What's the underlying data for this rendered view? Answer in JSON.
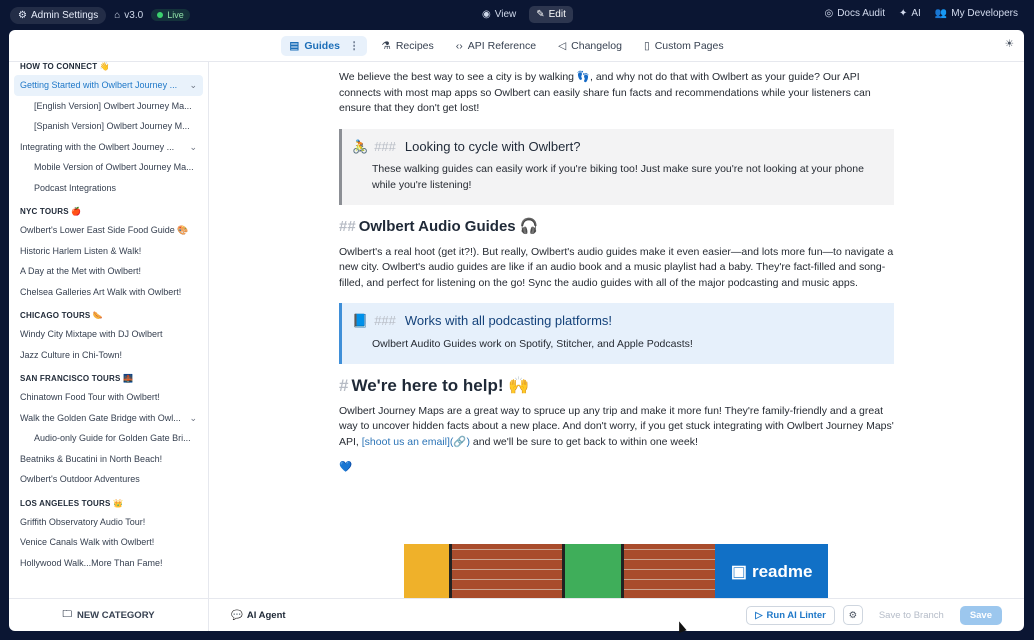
{
  "topbar": {
    "admin_label": "Admin Settings",
    "version": "v3.0",
    "live": "Live",
    "view": "View",
    "edit": "Edit",
    "docs_audit": "Docs Audit",
    "ai": "AI",
    "my_developers": "My Developers"
  },
  "nav": {
    "items": [
      {
        "label": "Guides"
      },
      {
        "label": "Recipes"
      },
      {
        "label": "API Reference"
      },
      {
        "label": "Changelog"
      },
      {
        "label": "Custom Pages"
      }
    ]
  },
  "sidebar": {
    "groups": [
      {
        "title": "HOW TO CONNECT 👋",
        "items": [
          {
            "label": "Getting Started with Owlbert Journey ..."
          },
          {
            "label": "[English Version] Owlbert Journey Ma..."
          },
          {
            "label": "[Spanish Version] Owlbert Journey M..."
          },
          {
            "label": "Integrating with the Owlbert Journey ..."
          },
          {
            "label": "Mobile Version of Owlbert Journey Ma..."
          },
          {
            "label": "Podcast Integrations"
          }
        ]
      },
      {
        "title": "NYC TOURS 🍎",
        "items": [
          {
            "label": "Owlbert's Lower East Side Food Guide 🎨"
          },
          {
            "label": "Historic Harlem Listen & Walk!"
          },
          {
            "label": "A Day at the Met with Owlbert!"
          },
          {
            "label": "Chelsea Galleries Art Walk with Owlbert!"
          }
        ]
      },
      {
        "title": "CHICAGO TOURS 🌭",
        "items": [
          {
            "label": "Windy City Mixtape with DJ Owlbert"
          },
          {
            "label": "Jazz Culture in Chi-Town!"
          }
        ]
      },
      {
        "title": "SAN FRANCISCO TOURS 🌉",
        "items": [
          {
            "label": "Chinatown Food Tour with Owlbert!"
          },
          {
            "label": "Walk the Golden Gate Bridge with Owl..."
          },
          {
            "label": "Audio-only Guide for Golden Gate Bri..."
          },
          {
            "label": "Beatniks & Bucatini in North Beach!"
          },
          {
            "label": "Owlbert's Outdoor Adventures"
          }
        ]
      },
      {
        "title": "LOS ANGELES TOURS 👑",
        "items": [
          {
            "label": "Griffith Observatory Audio Tour!"
          },
          {
            "label": "Venice Canals Walk with Owlbert!"
          },
          {
            "label": "Hollywood Walk...More Than Fame!"
          }
        ]
      }
    ]
  },
  "content": {
    "intro": "We believe the best way to see a city is by walking 👣, and why not do that with Owlbert as your guide? Our API connects with most map apps so Owlbert can easily share fun facts and recommendations while your listeners can ensure that they don't get lost!",
    "callout1_hash": "###",
    "callout1_title": "Looking to cycle with Owlbert?",
    "callout1_body": "These walking guides can easily work if you're biking too! Just make sure you're not looking at your phone while you're listening!",
    "h2_hash": "##",
    "h2_title": "Owlbert Audio Guides 🎧",
    "para2": "Owlbert's a real hoot (get it?!). But really, Owlbert's audio guides make it even easier—and lots more fun—to navigate a new city. Owlbert's audio guides are like if an audio book and a music playlist had a baby. They're fact-filled and song-filled, and perfect for listening on the go! Sync the audio guides with all of the major podcasting and music apps.",
    "callout2_hash": "###",
    "callout2_title": "Works with all podcasting platforms!",
    "callout2_body": "Owlbert Audito Guides work on Spotify, Stitcher, and Apple Podcasts!",
    "h1_hash": "#",
    "h1_title": "We're here to help! 🙌",
    "para3_a": "Owlbert Journey Maps are a great way to spruce up any trip and make it more fun! They're family-friendly and a great way to uncover hidden facts about a new place. And don't worry, if you get stuck integrating with Owlbert Journey Maps' API,",
    "para3_link": "[shoot us an email](🔗)",
    "para3_b": "and we'll be sure to get back to within one week!",
    "heart": "💙",
    "banner_text": "readme"
  },
  "bottombar": {
    "new_category": "NEW CATEGORY",
    "ai_agent": "AI Agent",
    "run_linter": "Run AI Linter",
    "save_to_branch": "Save to Branch",
    "save": "Save"
  }
}
